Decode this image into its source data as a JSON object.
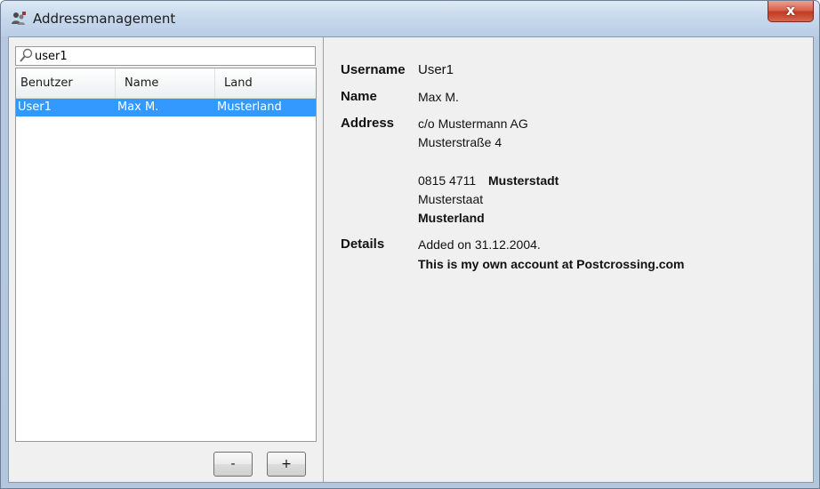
{
  "window": {
    "title": "Addressmanagement",
    "close_glyph": "x"
  },
  "search": {
    "value": "user1",
    "icon": "magnifier-icon"
  },
  "list": {
    "columns": [
      "Benutzer",
      "Name",
      "Land"
    ],
    "rows": [
      {
        "benutzer": "User1",
        "name": "Max M.",
        "land": "Musterland",
        "selected": true
      }
    ]
  },
  "buttons": {
    "remove_label": "-",
    "add_label": "+"
  },
  "details": {
    "username_label": "Username",
    "username_value": "User1",
    "name_label": "Name",
    "name_value": "Max M.",
    "address_label": "Address",
    "address_line1": "c/o Mustermann AG",
    "address_line2": "Musterstraße 4",
    "postal_code": "0815 4711",
    "city": "Musterstadt",
    "state": "Musterstaat",
    "country": "Musterland",
    "details_label": "Details",
    "details_added": "Added on 31.12.2004.",
    "details_note": "This is my own account at Postcrossing.com"
  },
  "colors": {
    "selection": "#3399ff",
    "close_button": "#c13a22"
  }
}
